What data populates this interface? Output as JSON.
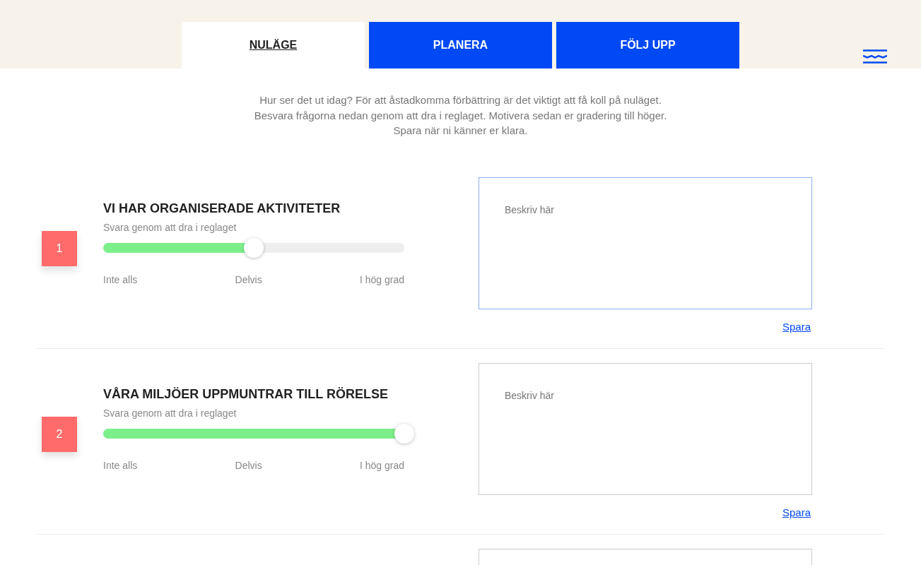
{
  "tabs": [
    {
      "label": "NULÄGE",
      "selected": true
    },
    {
      "label": "PLANERA",
      "selected": false
    },
    {
      "label": "FÖLJ UPP",
      "selected": false
    }
  ],
  "intro": [
    "Hur ser det ut idag? För att åstadkomma förbättring är det viktigt att få koll på nuläget.",
    "Besvara frågorna nedan genom att dra i reglaget. Motivera sedan er gradering till höger.",
    "Spara när ni känner er klara."
  ],
  "questions": [
    {
      "number": "1",
      "title": "VI HAR ORGANISERADE AKTIVITETER",
      "hint": "Svara genom att dra i reglaget",
      "level": 0.5,
      "scale": [
        "Inte alls",
        "Delvis",
        "I hög grad"
      ],
      "placeholder": "Beskriv här",
      "focused": true,
      "save": "Spara"
    },
    {
      "number": "2",
      "title": "VÅRA MILJÖER UPPMUNTRAR TILL RÖRELSE",
      "hint": "Svara genom att dra i reglaget",
      "level": 1.0,
      "scale": [
        "Inte alls",
        "Delvis",
        "I hög grad"
      ],
      "placeholder": "Beskriv här",
      "focused": false,
      "save": "Spara"
    },
    {
      "focused": false
    }
  ]
}
